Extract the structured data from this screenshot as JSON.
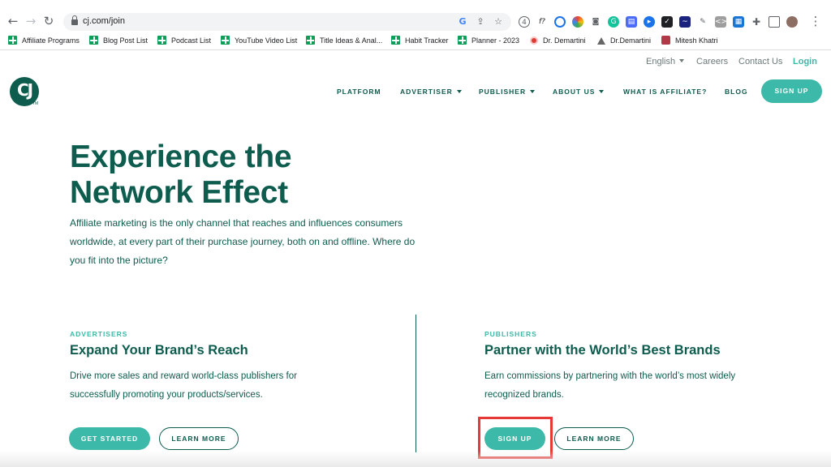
{
  "browser": {
    "url": "cj.com/join",
    "bookmarks": [
      {
        "label": "Affiliate Programs",
        "icon": "sheets-icon"
      },
      {
        "label": "Blog Post List",
        "icon": "sheets-icon"
      },
      {
        "label": "Podcast List",
        "icon": "sheets-icon"
      },
      {
        "label": "YouTube Video List",
        "icon": "sheets-icon"
      },
      {
        "label": "Title Ideas & Anal...",
        "icon": "sheets-icon"
      },
      {
        "label": "Habit Tracker",
        "icon": "sheets-icon"
      },
      {
        "label": "Planner - 2023",
        "icon": "sheets-icon"
      },
      {
        "label": "Dr. Demartini",
        "icon": "youtube-icon"
      },
      {
        "label": "Dr.Demartini",
        "icon": "triangle-icon"
      },
      {
        "label": "Mitesh Khatri",
        "icon": "profile-icon"
      }
    ]
  },
  "utility_nav": {
    "language": "English",
    "careers": "Careers",
    "contact": "Contact Us",
    "login": "Login"
  },
  "logo": {
    "text": "CJ",
    "tm": "TM"
  },
  "main_nav": {
    "items": [
      "PLATFORM",
      "ADVERTISER",
      "PUBLISHER",
      "ABOUT US",
      "WHAT IS AFFILIATE?",
      "BLOG"
    ],
    "signup": "SIGN UP"
  },
  "hero": {
    "title": "Experience the Network Effect",
    "text": "Affiliate marketing is the only channel that reaches and influences consumers worldwide, at every part of their purchase journey, both on and offline. Where do you fit into the picture?"
  },
  "advertisers": {
    "label": "ADVERTISERS",
    "title": "Expand Your Brand’s Reach",
    "text": "Drive more sales and reward world-class publishers for successfully promoting your products/services.",
    "primary": "GET STARTED",
    "secondary": "LEARN MORE"
  },
  "publishers": {
    "label": "PUBLISHERS",
    "title": "Partner with the World’s Best Brands",
    "text": "Earn commissions by partnering with the world’s most widely recognized brands.",
    "primary": "SIGN UP",
    "secondary": "LEARN MORE"
  },
  "colors": {
    "brand_dark": "#0d5c4e",
    "accent": "#3cb9a8",
    "highlight": "#e53935"
  }
}
